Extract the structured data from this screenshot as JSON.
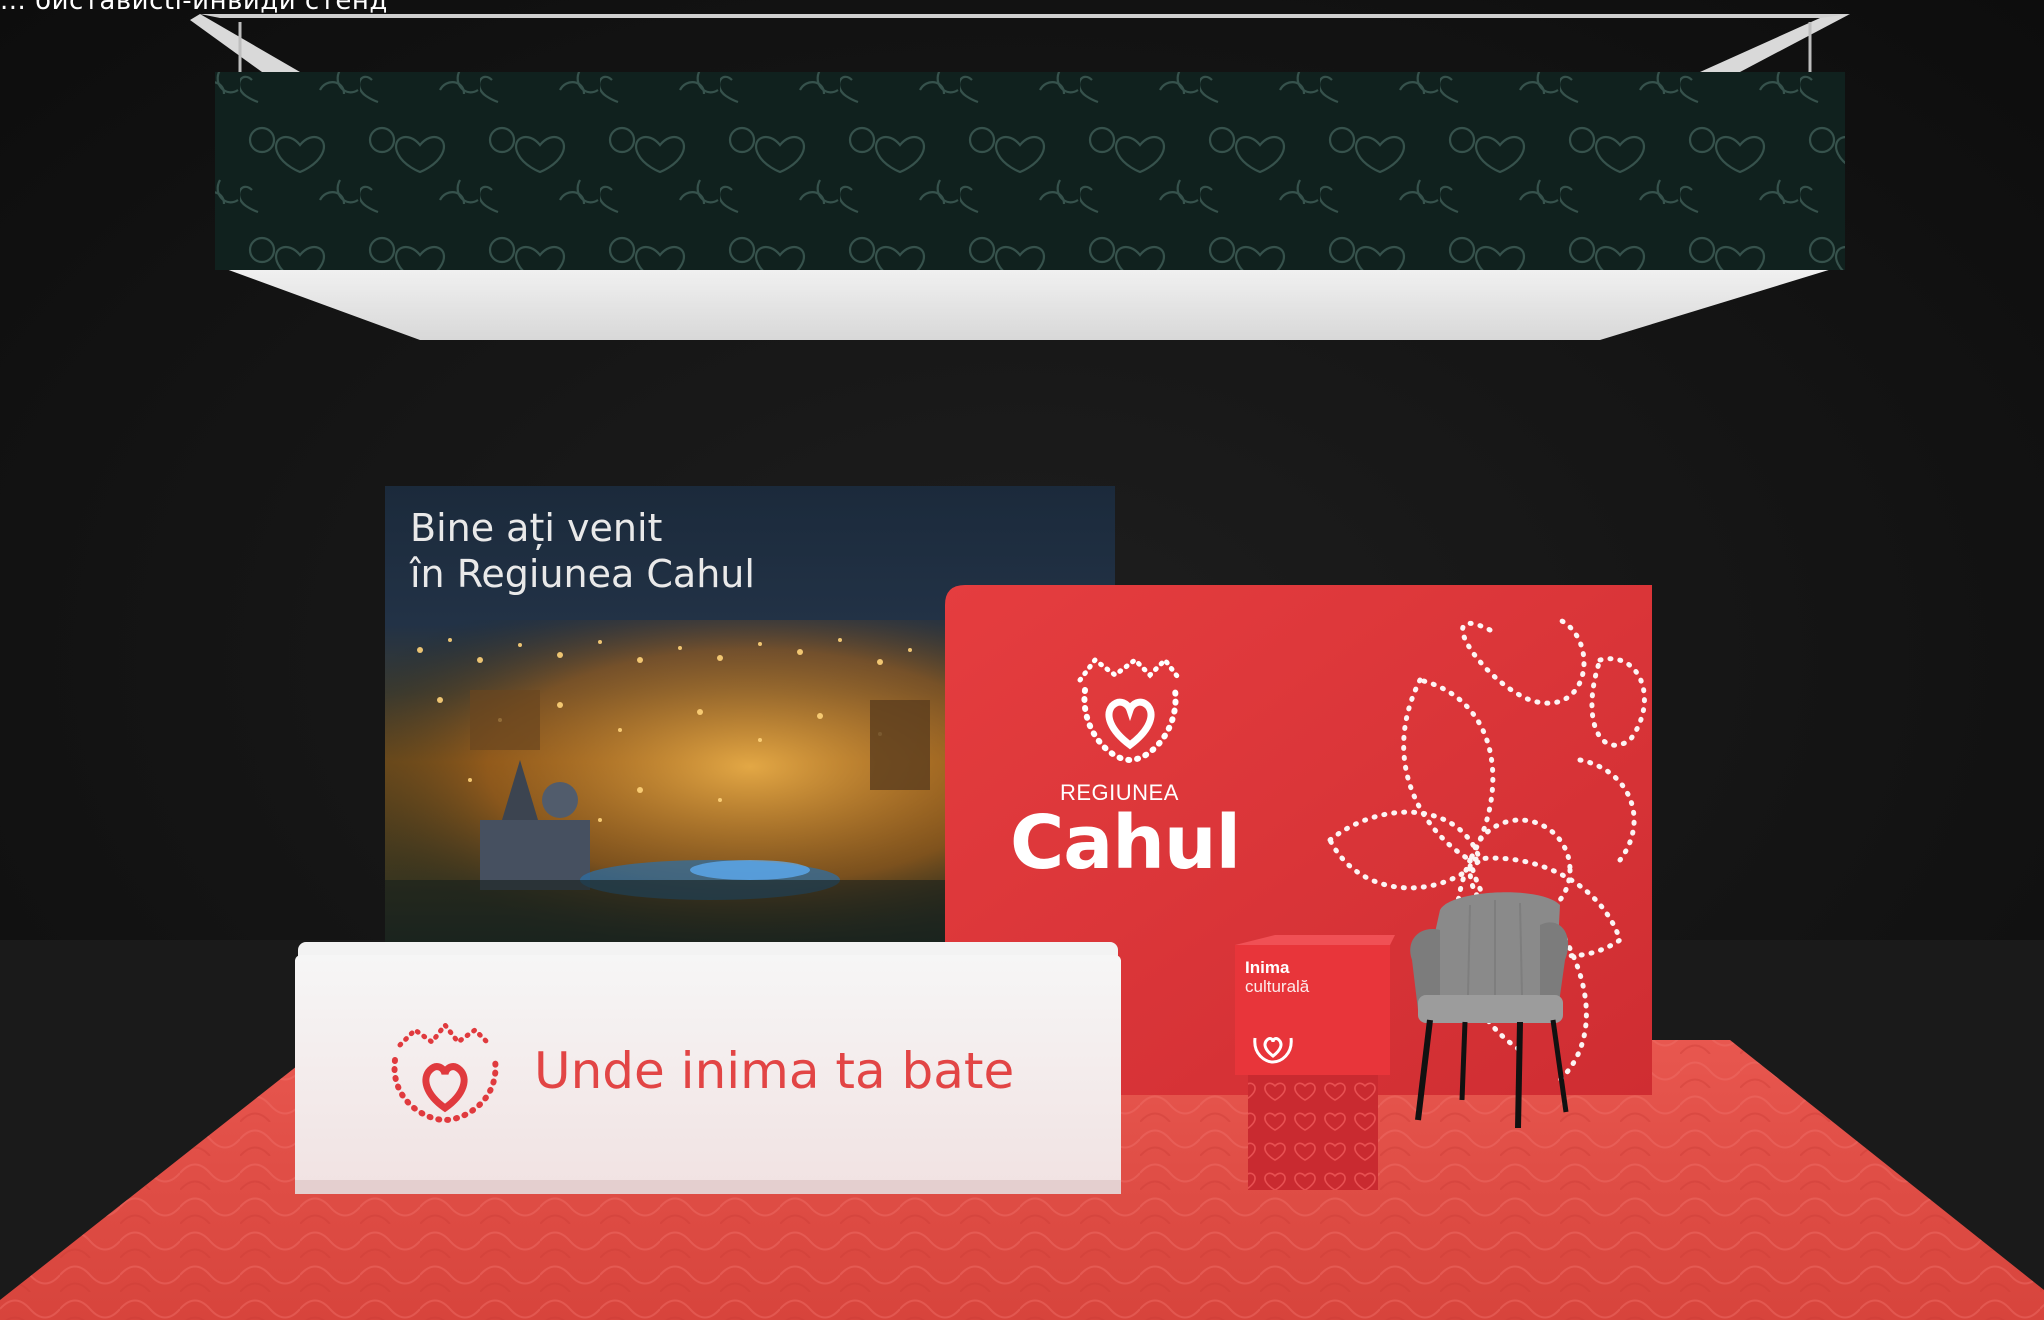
{
  "caption": "... бистависti-инвиди стенд",
  "welcome_panel": {
    "line1": "Bine ați venit",
    "line2": "în Regiunea Cahul"
  },
  "brand_wall": {
    "small_label": "REGIUNEA",
    "big_label": "Cahul"
  },
  "counter": {
    "slogan": "Unde inima ta bate"
  },
  "cube": {
    "line1": "Inima",
    "line2": "culturală"
  },
  "colors": {
    "brand_red": "#e0373b",
    "floor_red": "#e9564d",
    "banner_dark": "#11221f",
    "background": "#121212"
  },
  "icons": {
    "logo": "heart-lotus-icon",
    "chair": "armchair-icon"
  }
}
